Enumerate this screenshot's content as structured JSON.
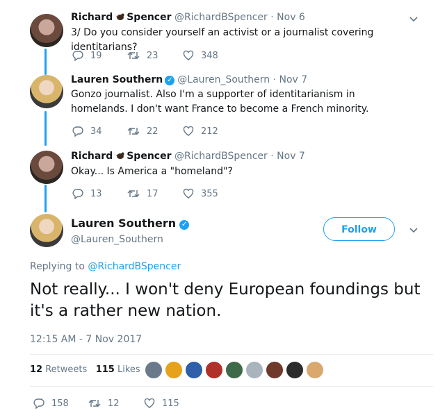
{
  "tweets": [
    {
      "name": "Richard",
      "name_after": "Spencer",
      "handle": "@RichardBSpencer",
      "separator": "·",
      "date": "Nov 6",
      "text": "3/ Do you consider yourself an activist or a journalist covering identitarians?",
      "replies": "19",
      "retweets": "23",
      "likes": "348"
    },
    {
      "name": "Lauren Southern",
      "handle": "@Lauren_Southern",
      "separator": "·",
      "date": "Nov 7",
      "text": "Gonzo journalist. Also I'm a supporter of identitarianism in homelands. I don't want France to become a French minority.",
      "replies": "34",
      "retweets": "22",
      "likes": "212"
    },
    {
      "name": "Richard",
      "name_after": "Spencer",
      "handle": "@RichardBSpencer",
      "separator": "·",
      "date": "Nov 7",
      "text": "Okay... Is America a \"homeland\"?",
      "replies": "13",
      "retweets": "17",
      "likes": "355"
    }
  ],
  "main": {
    "name": "Lauren Southern",
    "handle": "@Lauren_Southern",
    "follow_label": "Follow",
    "replying_prefix": "Replying to",
    "replying_to": "@RichardBSpencer",
    "text": "Not really... I won't deny European foundings but it's a rather new nation.",
    "timestamp": "12:15 AM - 7 Nov 2017",
    "retweet_count": "12",
    "retweets_label": "Retweets",
    "like_count": "115",
    "likes_label": "Likes",
    "replies": "158",
    "retweets": "12",
    "likes": "115"
  },
  "colors": {
    "accent": "#1da1f2",
    "muted": "#657786",
    "text": "#14171a",
    "divider": "#e6ecf0"
  },
  "icons": [
    "reply-icon",
    "retweet-icon",
    "like-icon",
    "chevron-down-icon",
    "verified-icon",
    "bird-icon"
  ]
}
